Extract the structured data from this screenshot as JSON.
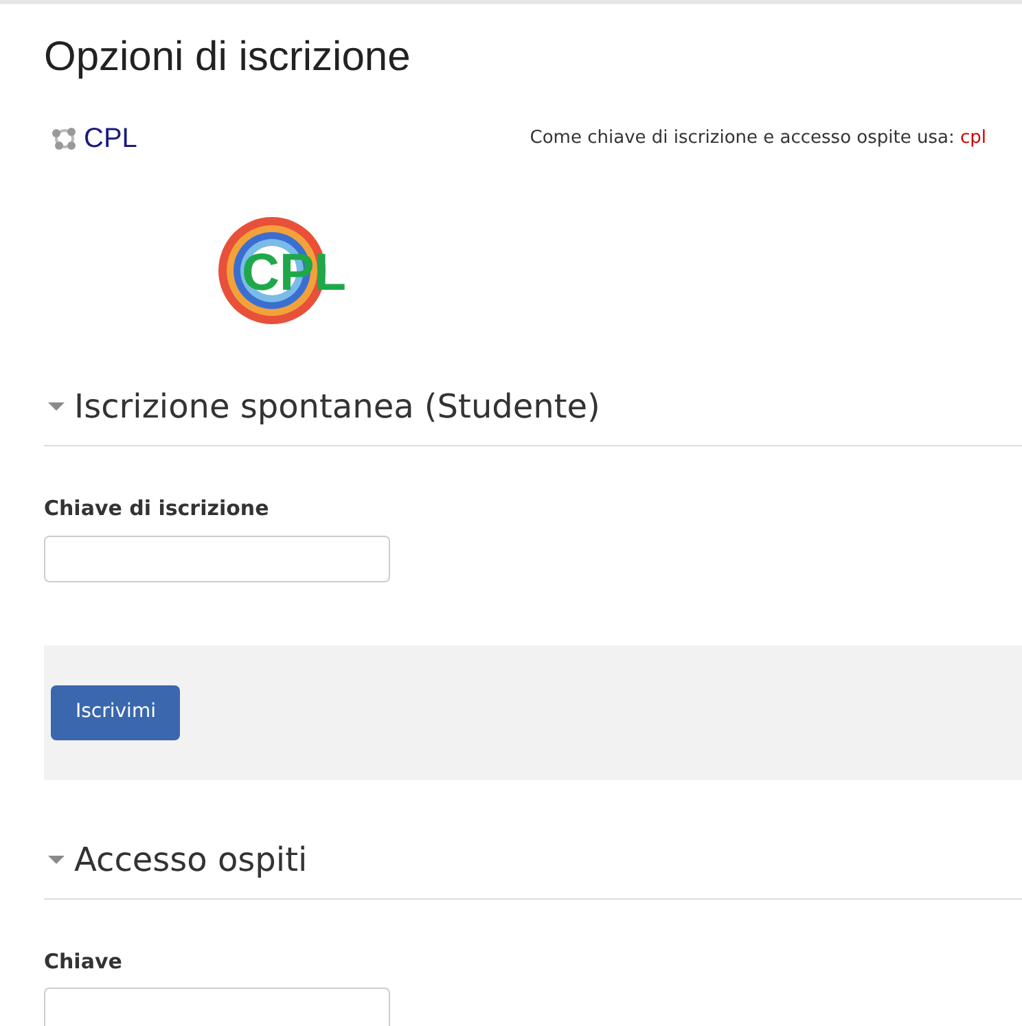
{
  "title": "Opzioni di iscrizione",
  "course": {
    "name": "CPL",
    "key_note": "Come chiave di iscrizione e accesso ospite usa:",
    "key_value": "cpl",
    "logo_text": "CPL"
  },
  "sections": [
    {
      "title": "Iscrizione spontanea (Studente)",
      "expanded": true,
      "field_label": "Chiave di iscrizione",
      "button": "Iscrivimi"
    },
    {
      "title": "Accesso ospiti",
      "expanded": true,
      "field_label": "Chiave"
    }
  ]
}
